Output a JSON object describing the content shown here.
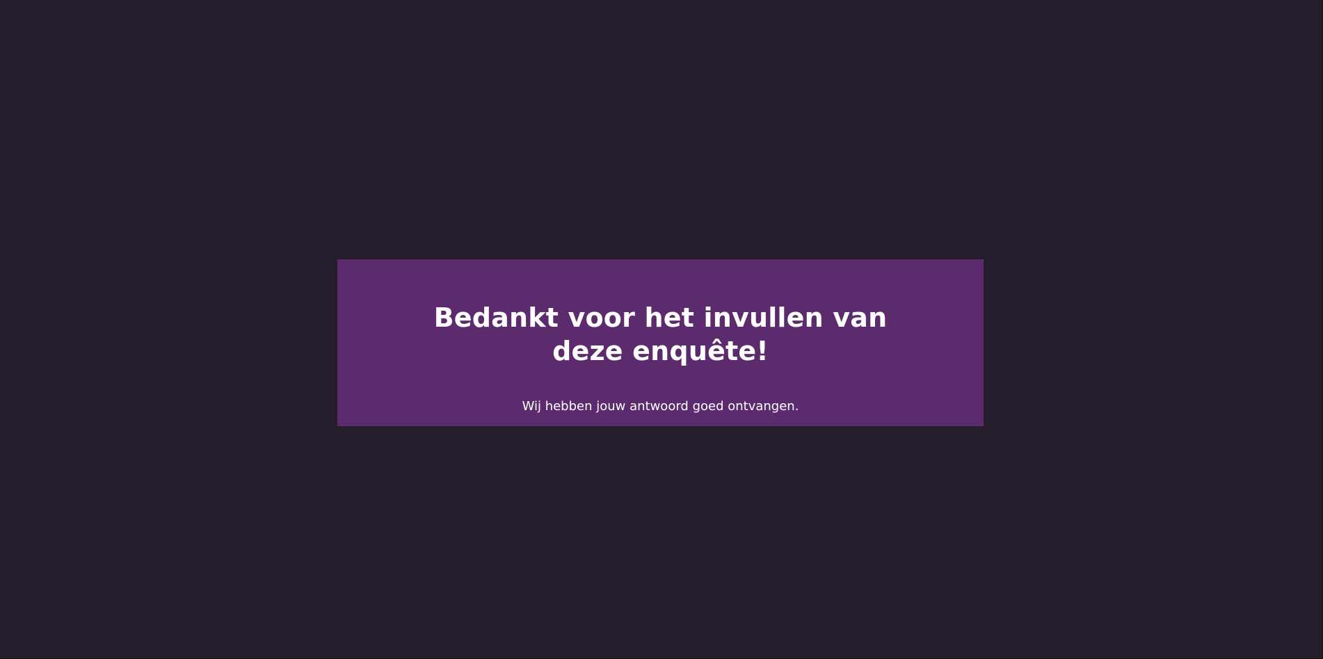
{
  "page": {
    "background_color": "#261e2d"
  },
  "card": {
    "background_color": "#5b2b6e",
    "title": "Bedankt voor het invullen van deze enquête!",
    "message": "Wij hebben jouw antwoord goed ontvangen."
  }
}
